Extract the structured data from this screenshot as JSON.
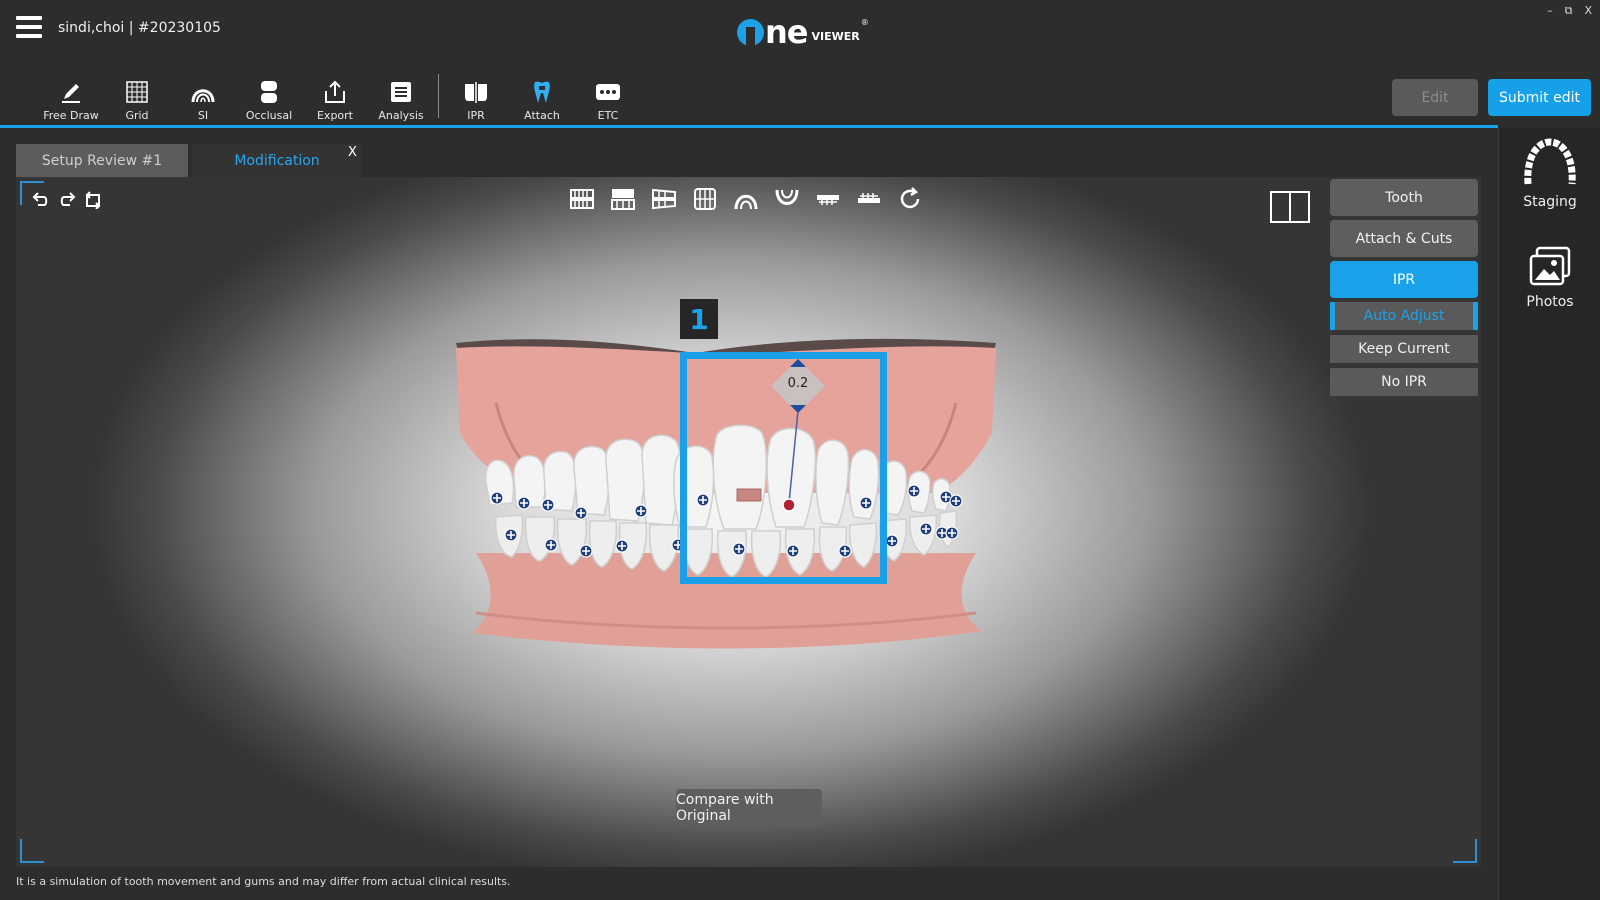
{
  "header": {
    "patient_label": "sindi,choi | #20230105",
    "logo_word": "ne",
    "logo_sub": "VIEWER",
    "logo_reg": "®",
    "window_controls": {
      "minimize": "–",
      "restore": "⧉",
      "close": "X"
    }
  },
  "toolbar": {
    "tools": [
      {
        "label": "Free Draw",
        "icon": "pencil-icon"
      },
      {
        "label": "Grid",
        "icon": "grid-icon"
      },
      {
        "label": "SI",
        "icon": "arch-icon"
      },
      {
        "label": "Occlusal",
        "icon": "occlusal-icon"
      },
      {
        "label": "Export",
        "icon": "export-icon"
      },
      {
        "label": "Analysis",
        "icon": "list-icon"
      },
      {
        "label": "IPR",
        "icon": "ipr-icon"
      },
      {
        "label": "Attach",
        "icon": "attach-icon"
      },
      {
        "label": "ETC",
        "icon": "more-icon"
      }
    ],
    "edit_label": "Edit",
    "submit_label": "Submit edit"
  },
  "side_panel": {
    "items": [
      {
        "label": "Staging",
        "icon": "staging-icon"
      },
      {
        "label": "Photos",
        "icon": "photos-icon"
      }
    ]
  },
  "tabs": {
    "items": [
      {
        "label": "Setup Review #1"
      },
      {
        "label": "Modification"
      }
    ],
    "close_label": "X"
  },
  "viewport": {
    "right_menu": {
      "tooth": "Tooth",
      "attach_cuts": "Attach & Cuts",
      "ipr": "IPR",
      "auto_adjust": "Auto Adjust",
      "keep_current": "Keep Current",
      "no_ipr": "No IPR"
    },
    "tooth_number": "1",
    "ipr_value": "0.2",
    "compare_label": "Compare with Original",
    "accent_color": "#1aa3ea"
  },
  "footer": {
    "disclaimer": "It is a simulation of tooth movement and gums and may differ from actual clinical results."
  }
}
